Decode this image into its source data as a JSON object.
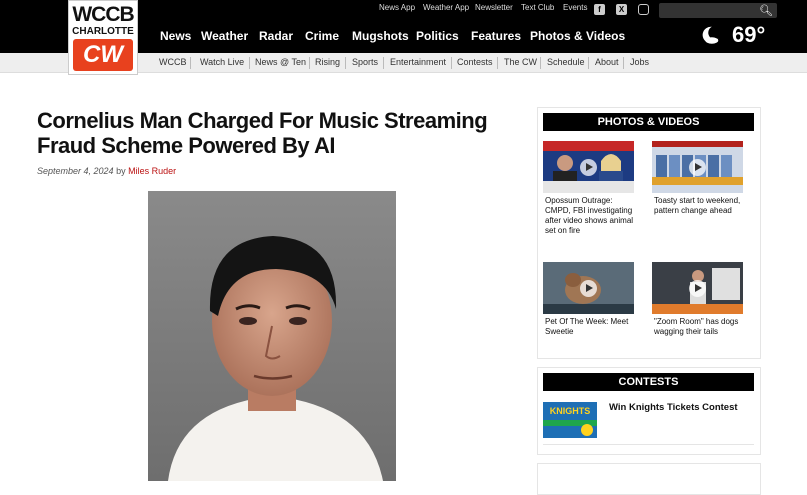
{
  "brand": {
    "name": "WCCB",
    "city": "CHARLOTTE",
    "network": "CW"
  },
  "utility_links": [
    "News App",
    "Weather App",
    "Newsletter",
    "Text Club",
    "Events"
  ],
  "social_icons": [
    "facebook-icon",
    "x-icon",
    "instagram-icon"
  ],
  "main_nav": [
    "News",
    "Weather",
    "Radar",
    "Crime",
    "Mugshots",
    "Politics",
    "Features",
    "Photos & Videos"
  ],
  "weather": {
    "temperature": "69°",
    "icon": "moon-cloud-icon"
  },
  "sub_nav": [
    "WCCB",
    "Watch Live",
    "News @ Ten",
    "Rising",
    "Sports",
    "Entertainment",
    "Contests",
    "The CW",
    "Schedule",
    "About",
    "Jobs"
  ],
  "article": {
    "title": "Cornelius Man Charged For Music Streaming Fraud Scheme Powered By AI",
    "date": "September 4, 2024",
    "by": "by",
    "author": "Miles Ruder"
  },
  "photos_videos": {
    "heading": "PHOTOS & VIDEOS",
    "items": [
      {
        "caption": "Opossum Outrage: CMPD, FBI investigating after video shows animal set on fire"
      },
      {
        "caption": "Toasty start to weekend, pattern change ahead"
      },
      {
        "caption": "Pet Of The Week: Meet Sweetie"
      },
      {
        "caption": "\"Zoom Room\" has dogs wagging their tails"
      }
    ]
  },
  "contests": {
    "heading": "CONTESTS",
    "items": [
      {
        "title": "Win Knights Tickets Contest",
        "thumb_text": "KNIGHTS"
      }
    ]
  },
  "colors": {
    "topbar": "#000000",
    "accent_red": "#e8411e",
    "author_link": "#bb1111"
  }
}
